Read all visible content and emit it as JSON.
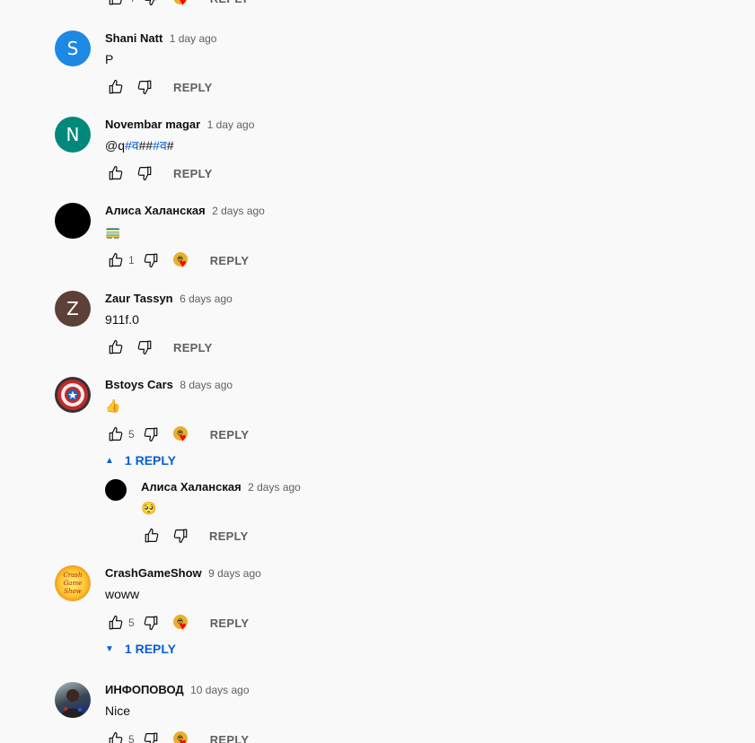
{
  "ui": {
    "reply_label": "REPLY",
    "thumb_up_icon": "thumbs-up-icon",
    "thumb_down_icon": "thumbs-down-icon",
    "heart_icon": "creator-heart-icon"
  },
  "top_partial": {
    "likes": "4",
    "reply_label": "REPLY"
  },
  "comments": [
    {
      "author": "Shani Natt",
      "time": "1 day ago",
      "text": "P",
      "avatar_letter": "S",
      "avatar_color": "#1e88e5",
      "likes": ""
    },
    {
      "author": "Novembar magar",
      "time": "1 day ago",
      "text_parts": [
        "@q",
        "#व",
        "##",
        "#व",
        "#"
      ],
      "avatar_letter": "N",
      "avatar_color": "#00897b",
      "likes": ""
    },
    {
      "author": "Алиса Халанская",
      "time": "2 days ago",
      "text": "🚃",
      "avatar_letter": "",
      "avatar_color": "#000000",
      "likes": "1",
      "hearted": true
    },
    {
      "author": "Zaur Tassyn",
      "time": "6 days ago",
      "text": "911f.0",
      "avatar_letter": "Z",
      "avatar_color": "#5d4037",
      "likes": ""
    },
    {
      "author": "Bstoys Cars",
      "time": "8 days ago",
      "text": "👍",
      "avatar_letter": "",
      "avatar_color": "#c62828",
      "likes": "5",
      "hearted": true,
      "replies_label": "1 REPLY",
      "replies_expanded": true
    },
    {
      "author": "CrashGameShow",
      "time": "9 days ago",
      "text": "woww",
      "avatar_letter": "",
      "avatar_color": "#fbc02d",
      "avatar_text": "Crash Game Show",
      "likes": "5",
      "hearted": true,
      "replies_label": "1 REPLY",
      "replies_expanded": false
    },
    {
      "author": "ИНФОПОВОД",
      "time": "10 days ago",
      "text": "Nice",
      "avatar_letter": "",
      "avatar_color": "#4a4a6a",
      "likes": "5",
      "hearted": true
    }
  ],
  "nested_reply": {
    "author": "Алиса Халанская",
    "time": "2 days ago",
    "text": "🥺",
    "avatar_color": "#000000",
    "likes": ""
  }
}
